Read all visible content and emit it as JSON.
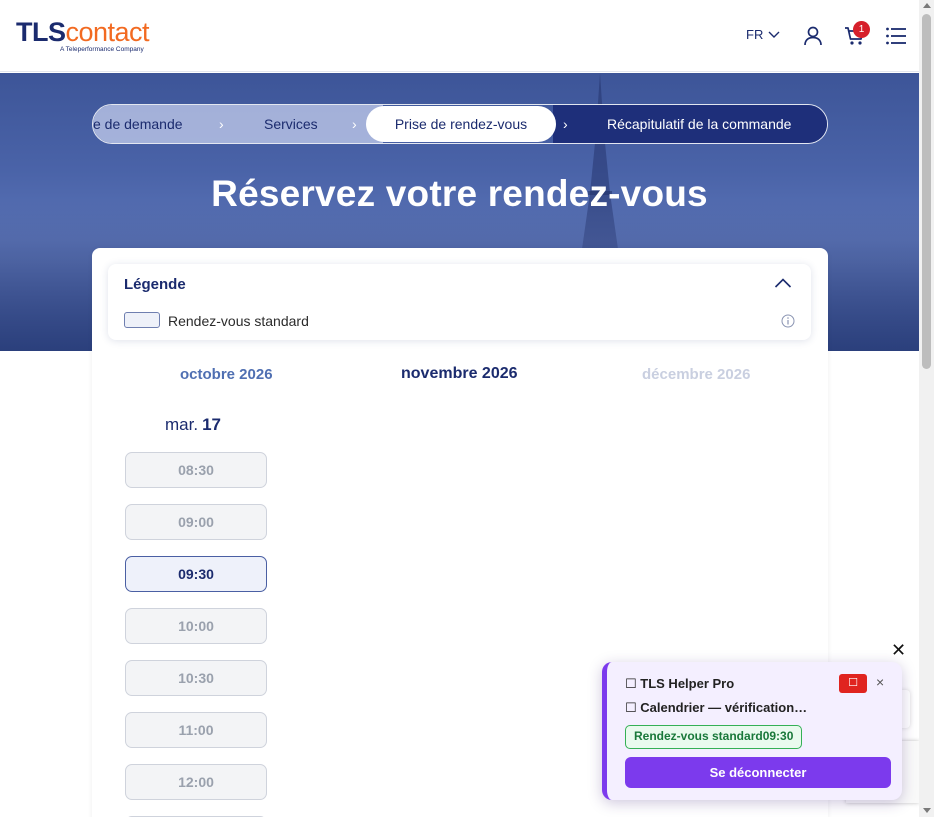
{
  "header": {
    "logo_main_bold": "TLS",
    "logo_main_light": "contact",
    "logo_sub": "A Teleperformance Company",
    "language": "FR",
    "cart_count": "1",
    "icons": [
      "chevron-down-icon",
      "user-icon",
      "cart-icon",
      "menu-icon"
    ]
  },
  "hero": {
    "steps": [
      "e de demande",
      "Services",
      "Prise de rendez-vous",
      "Récapitulatif de la commande"
    ],
    "active_step": 2,
    "title": "Réservez votre rendez-vous"
  },
  "legend": {
    "title": "Légende",
    "items": [
      {
        "label": "Rendez-vous standard"
      }
    ]
  },
  "calendar": {
    "months": {
      "previous": "octobre 2026",
      "current": "novembre 2026",
      "next": "décembre 2026"
    },
    "day_name": "mar.",
    "day_number": "17",
    "slots": [
      {
        "time": "08:30",
        "available": false
      },
      {
        "time": "09:00",
        "available": false
      },
      {
        "time": "09:30",
        "available": true
      },
      {
        "time": "10:00",
        "available": false
      },
      {
        "time": "10:30",
        "available": false
      },
      {
        "time": "11:00",
        "available": false
      },
      {
        "time": "12:00",
        "available": false
      }
    ]
  },
  "helper": {
    "close_symbol": "✕",
    "title": "☐ TLS Helper Pro",
    "stop_symbol": "☐",
    "close_label": "×",
    "status": "☐ Calendrier — vérification…",
    "chip": "Rendez-vous standard09:30",
    "logout": "Se déconnecter"
  },
  "colors": {
    "brand_navy": "#1b2b6e",
    "brand_orange": "#f26a21",
    "helper_purple": "#7c3aed",
    "chip_green": "#34b055",
    "badge_red": "#d6202b"
  }
}
